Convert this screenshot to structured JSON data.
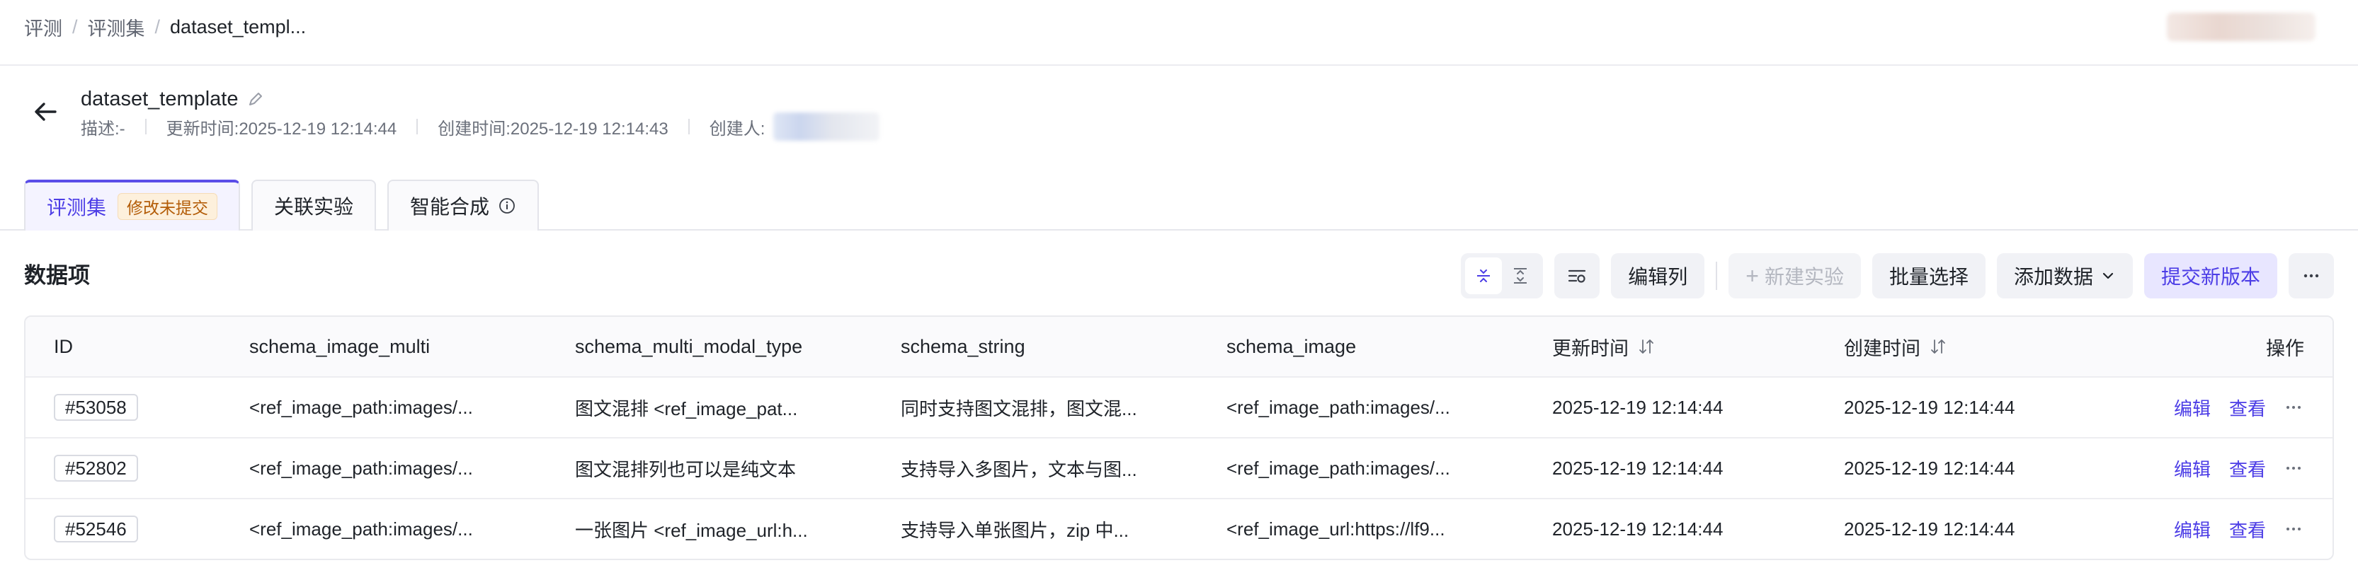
{
  "breadcrumb": {
    "items": [
      "评测",
      "评测集"
    ],
    "separator": "/",
    "current": "dataset_templ..."
  },
  "header": {
    "title": "dataset_template",
    "description": "描述:-",
    "updated": "更新时间:2025-12-19 12:14:44",
    "created": "创建时间:2025-12-19 12:14:43",
    "creator_label": "创建人:"
  },
  "tabs": [
    {
      "label": "评测集",
      "badge": "修改未提交",
      "active": true
    },
    {
      "label": "关联实验"
    },
    {
      "label": "智能合成"
    }
  ],
  "section": {
    "title": "数据项"
  },
  "toolbar": {
    "edit_columns": "编辑列",
    "new_experiment": "新建实验",
    "batch_select": "批量选择",
    "add_data": "添加数据",
    "submit_version": "提交新版本"
  },
  "table": {
    "columns": [
      "ID",
      "schema_image_multi",
      "schema_multi_modal_type",
      "schema_string",
      "schema_image",
      "更新时间",
      "创建时间",
      "操作"
    ],
    "rows": [
      {
        "id": "#53058",
        "image_multi": "<ref_image_path:images/...",
        "multi_modal": "图文混排 <ref_image_pat...",
        "string": "同时支持图文混排，图文混...",
        "image": "<ref_image_path:images/...",
        "updated": "2025-12-19 12:14:44",
        "created": "2025-12-19 12:14:44"
      },
      {
        "id": "#52802",
        "image_multi": "<ref_image_path:images/...",
        "multi_modal": "图文混排列也可以是纯文本",
        "string": "支持导入多图片，文本与图...",
        "image": "<ref_image_path:images/...",
        "updated": "2025-12-19 12:14:44",
        "created": "2025-12-19 12:14:44"
      },
      {
        "id": "#52546",
        "image_multi": "<ref_image_path:images/...",
        "multi_modal": "一张图片 <ref_image_url:h...",
        "string": "支持导入单张图片，zip 中...",
        "image": "<ref_image_url:https://lf9...",
        "updated": "2025-12-19 12:14:44",
        "created": "2025-12-19 12:14:44"
      }
    ],
    "actions": {
      "edit": "编辑",
      "view": "查看"
    }
  },
  "colors": {
    "accent": "#4c3de6",
    "badge_text": "#b35c07",
    "badge_bg": "#fdf0dc"
  }
}
